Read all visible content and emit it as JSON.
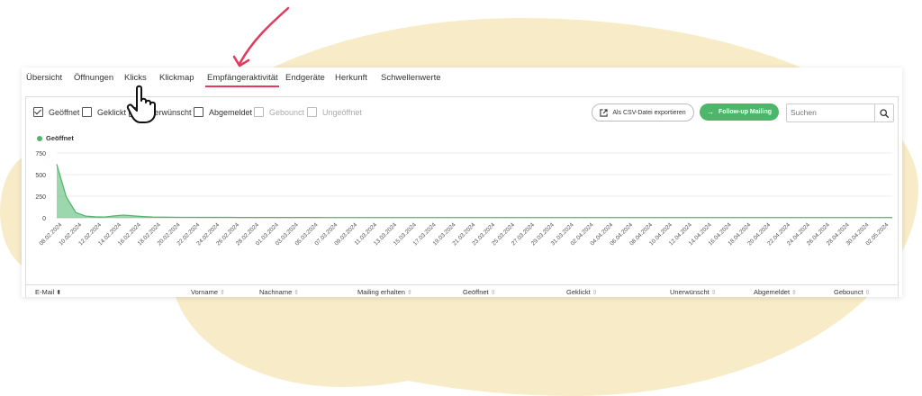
{
  "tabs": [
    {
      "label": "Übersicht"
    },
    {
      "label": "Öffnungen"
    },
    {
      "label": "Klicks"
    },
    {
      "label": "Klickmap"
    },
    {
      "label": "Empfängeraktivität",
      "active": true
    },
    {
      "label": "Endgeräte"
    },
    {
      "label": "Herkunft"
    },
    {
      "label": "Schwellenwerte"
    }
  ],
  "filters": [
    {
      "label": "Geöffnet",
      "checked": true,
      "disabled": false
    },
    {
      "label": "Geklickt",
      "checked": false,
      "disabled": false
    },
    {
      "label": "Unerwünscht",
      "checked": false,
      "disabled": false
    },
    {
      "label": "Abgemeldet",
      "checked": false,
      "disabled": false
    },
    {
      "label": "Gebounct",
      "checked": false,
      "disabled": true
    },
    {
      "label": "Ungeöffnet",
      "checked": false,
      "disabled": true
    }
  ],
  "toolbar": {
    "export_label": "Als CSV-Datei exportieren",
    "export_icon": "external-link-icon",
    "follow_label": "Follow-up Mailing",
    "follow_icon": "arrow-right-icon",
    "search_placeholder": "Suchen",
    "search_icon": "search-icon"
  },
  "colors": {
    "accent": "#e23a5a",
    "series": "#4cb66a",
    "background_blob": "#f8ecc8"
  },
  "chart_data": {
    "type": "area",
    "legend": "top-left",
    "ylim": [
      0,
      750
    ],
    "yticks": [
      "750",
      "500",
      "250",
      "0"
    ],
    "series": [
      {
        "name": "Geöffnet",
        "color": "#4cb66a",
        "values": [
          620,
          240,
          60,
          20,
          12,
          10,
          22,
          32,
          22,
          14,
          9,
          8,
          7,
          6,
          6,
          5,
          5,
          5,
          5,
          4,
          4,
          4,
          4,
          4,
          4,
          4,
          4,
          4,
          3,
          3,
          3,
          3,
          3,
          3,
          3,
          3,
          3,
          3,
          3,
          3,
          3,
          3,
          3,
          3,
          3,
          3,
          3,
          3,
          3,
          3,
          3,
          3,
          3,
          3,
          3,
          3,
          3,
          3,
          3,
          3,
          3,
          3,
          3,
          3,
          3,
          3,
          3,
          3,
          3,
          3,
          3,
          3,
          3,
          3,
          3,
          3,
          3,
          3,
          3,
          3,
          3,
          3,
          3,
          3,
          3,
          3,
          3,
          3
        ]
      }
    ],
    "x": [
      "08.02.2024",
      "10.02.2024",
      "12.02.2024",
      "14.02.2024",
      "16.02.2024",
      "18.02.2024",
      "20.02.2024",
      "22.02.2024",
      "24.02.2024",
      "26.02.2024",
      "28.02.2024",
      "01.03.2024",
      "03.03.2024",
      "05.03.2024",
      "07.03.2024",
      "09.03.2024",
      "11.03.2024",
      "13.03.2024",
      "15.03.2024",
      "17.03.2024",
      "19.03.2024",
      "21.03.2024",
      "23.03.2024",
      "25.03.2024",
      "27.03.2024",
      "29.03.2024",
      "31.03.2024",
      "02.04.2024",
      "04.04.2024",
      "06.04.2024",
      "08.04.2024",
      "10.04.2024",
      "12.04.2024",
      "14.04.2024",
      "16.04.2024",
      "18.04.2024",
      "20.04.2024",
      "22.04.2024",
      "24.04.2024",
      "26.04.2024",
      "28.04.2024",
      "30.04.2024",
      "02.05.2024"
    ]
  },
  "table": {
    "columns": [
      {
        "label": "E-Mail",
        "sorted": true
      },
      {
        "label": "Vorname"
      },
      {
        "label": "Nachname"
      },
      {
        "label": "Mailing erhalten"
      },
      {
        "label": "Geöffnet"
      },
      {
        "label": "Geklickt"
      },
      {
        "label": "Unerwünscht"
      },
      {
        "label": "Abgemeldet"
      },
      {
        "label": "Gebounct"
      }
    ]
  }
}
